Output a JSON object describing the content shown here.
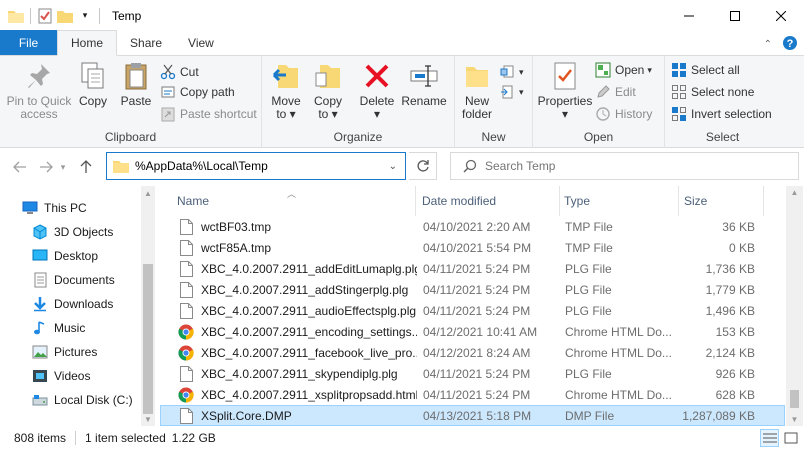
{
  "window": {
    "title": "Temp"
  },
  "tabs": [
    {
      "label": "File"
    },
    {
      "label": "Home"
    },
    {
      "label": "Share"
    },
    {
      "label": "View"
    }
  ],
  "ribbon": {
    "clipboard": {
      "label": "Clipboard",
      "pin_line1": "Pin to Quick",
      "pin_line2": "access",
      "copy": "Copy",
      "paste": "Paste",
      "cut": "Cut",
      "copy_path": "Copy path",
      "paste_shortcut": "Paste shortcut"
    },
    "organize": {
      "label": "Organize",
      "move_to": "Move",
      "move_to2": "to",
      "copy_to": "Copy",
      "copy_to2": "to",
      "delete": "Delete",
      "rename": "Rename"
    },
    "new": {
      "label": "New",
      "new_folder1": "New",
      "new_folder2": "folder"
    },
    "open": {
      "label": "Open",
      "properties": "Properties",
      "open": "Open",
      "edit": "Edit",
      "history": "History"
    },
    "select": {
      "label": "Select",
      "select_all": "Select all",
      "select_none": "Select none",
      "invert": "Invert selection"
    }
  },
  "address": {
    "path": "%AppData%\\Local\\Temp"
  },
  "search": {
    "placeholder": "Search Temp"
  },
  "sidebar": {
    "items": [
      {
        "label": "This PC",
        "icon": "pc-icon"
      },
      {
        "label": "3D Objects",
        "icon": "3d-objects-icon"
      },
      {
        "label": "Desktop",
        "icon": "desktop-icon"
      },
      {
        "label": "Documents",
        "icon": "documents-icon"
      },
      {
        "label": "Downloads",
        "icon": "downloads-icon"
      },
      {
        "label": "Music",
        "icon": "music-icon"
      },
      {
        "label": "Pictures",
        "icon": "pictures-icon"
      },
      {
        "label": "Videos",
        "icon": "videos-icon"
      },
      {
        "label": "Local Disk (C:)",
        "icon": "disk-icon"
      }
    ]
  },
  "columns": {
    "name": "Name",
    "date": "Date modified",
    "type": "Type",
    "size": "Size"
  },
  "files": [
    {
      "name": "wctBF03.tmp",
      "date": "04/10/2021 2:20 AM",
      "type": "TMP File",
      "size": "36 KB",
      "icon": "file"
    },
    {
      "name": "wctF85A.tmp",
      "date": "04/10/2021 5:54 PM",
      "type": "TMP File",
      "size": "0 KB",
      "icon": "file"
    },
    {
      "name": "XBC_4.0.2007.2911_addEditLumaplg.plg",
      "date": "04/11/2021 5:24 PM",
      "type": "PLG File",
      "size": "1,736 KB",
      "icon": "file"
    },
    {
      "name": "XBC_4.0.2007.2911_addStingerplg.plg",
      "date": "04/11/2021 5:24 PM",
      "type": "PLG File",
      "size": "1,779 KB",
      "icon": "file"
    },
    {
      "name": "XBC_4.0.2007.2911_audioEffectsplg.plg",
      "date": "04/11/2021 5:24 PM",
      "type": "PLG File",
      "size": "1,496 KB",
      "icon": "file"
    },
    {
      "name": "XBC_4.0.2007.2911_encoding_settings...",
      "date": "04/12/2021 10:41 AM",
      "type": "Chrome HTML Do...",
      "size": "153 KB",
      "icon": "chrome"
    },
    {
      "name": "XBC_4.0.2007.2911_facebook_live_pro...",
      "date": "04/12/2021 8:24 AM",
      "type": "Chrome HTML Do...",
      "size": "2,124 KB",
      "icon": "chrome"
    },
    {
      "name": "XBC_4.0.2007.2911_skypendiplg.plg",
      "date": "04/11/2021 5:24 PM",
      "type": "PLG File",
      "size": "926 KB",
      "icon": "file"
    },
    {
      "name": "XBC_4.0.2007.2911_xsplitpropsadd.html",
      "date": "04/11/2021 5:24 PM",
      "type": "Chrome HTML Do...",
      "size": "628 KB",
      "icon": "chrome"
    },
    {
      "name": "XSplit.Core.DMP",
      "date": "04/13/2021 5:18 PM",
      "type": "DMP File",
      "size": "1,287,089 KB",
      "icon": "file",
      "selected": true
    }
  ],
  "status": {
    "items": "808 items",
    "selected": "1 item selected",
    "size": "1.22 GB"
  },
  "colors": {
    "accent": "#1979ca",
    "selection": "#cce8ff",
    "folder": "#f8d775"
  }
}
